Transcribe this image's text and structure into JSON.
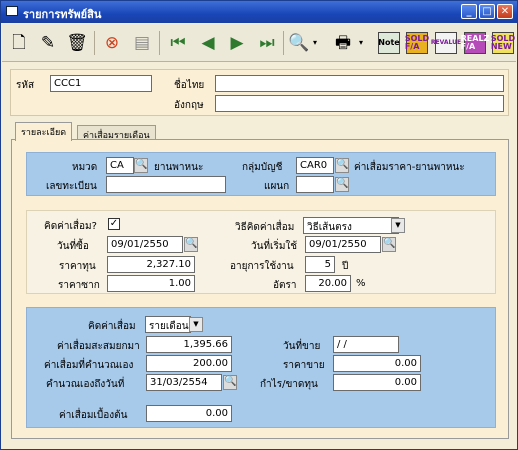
{
  "window": {
    "title": "รายการทรัพย์สิน",
    "minimize": "_",
    "maximize": "□",
    "close": "✕"
  },
  "toolbar": {
    "icons": [
      "new-doc-icon",
      "edit-icon",
      "delete-icon",
      "cancel-icon",
      "save-icon",
      "first-icon",
      "prev-icon",
      "next-icon",
      "last-icon",
      "search-icon",
      "print-icon"
    ],
    "note": "Note",
    "sold_fa": "SOLD\nF/A",
    "revalue": "REVALUE",
    "realz": "REALZ\nF/A",
    "sold_new": "SOLD\nNEW"
  },
  "header": {
    "code_label": "รหัส",
    "code_value": "CCC1",
    "thai_name_label": "ชื่อไทย",
    "thai_name_value": "",
    "eng_name_label": "อังกฤษ",
    "eng_name_value": ""
  },
  "tabs": [
    "รายละเอียด",
    "ค่าเสื่อมรายเดือน"
  ],
  "detail": {
    "category_label": "หมวด",
    "category_code": "CA",
    "category_name": "ยานพาหนะ",
    "account_group_label": "กลุ่มบัญชี",
    "account_group_code": "CAR0",
    "account_group_name": "ค่าเสื่อมราคา-ยานพาหนะ",
    "reg_no_label": "เลขทะเบียน",
    "reg_no_value": "",
    "dept_label": "แผนก",
    "dept_value": "",
    "calc_dep_label": "คิดค่าเสื่อม?",
    "calc_dep_checked": "✓",
    "dep_method_label": "วิธีคิดค่าเสื่อม",
    "dep_method_value": "วิธีเส้นตรง",
    "buy_date_label": "วันที่ซื้อ",
    "buy_date_value": "09/01/2550",
    "start_date_label": "วันที่เริ่มใช้",
    "start_date_value": "09/01/2550",
    "cost_label": "ราคาทุน",
    "cost_value": "2,327.10",
    "life_label": "อายุการใช้งาน",
    "life_value": "5",
    "life_unit": "ปี",
    "salvage_label": "ราคาซาก",
    "salvage_value": "1.00",
    "rate_label": "อัตรา",
    "rate_value": "20.00",
    "rate_unit": "%"
  },
  "depreciation": {
    "calc_label": "คิดค่าเสื่อม",
    "calc_value": "รายเดือน",
    "accum_label": "ค่าเสื่อมสะสมยกมา",
    "accum_value": "1,395.66",
    "manual_label": "ค่าเสื่อมที่คำนวณเอง",
    "manual_value": "200.00",
    "calc_to_label": "คำนวณเองถึงวันที่",
    "calc_to_value": "31/03/2554",
    "sale_date_label": "วันที่ขาย",
    "sale_date_value": "  /  /",
    "sale_price_label": "ราคาขาย",
    "sale_price_value": "0.00",
    "profit_label": "กำไร/ขาดทุน",
    "profit_value": "0.00",
    "initial_label": "ค่าเสื่อมเบื้องต้น",
    "initial_value": "0.00"
  }
}
